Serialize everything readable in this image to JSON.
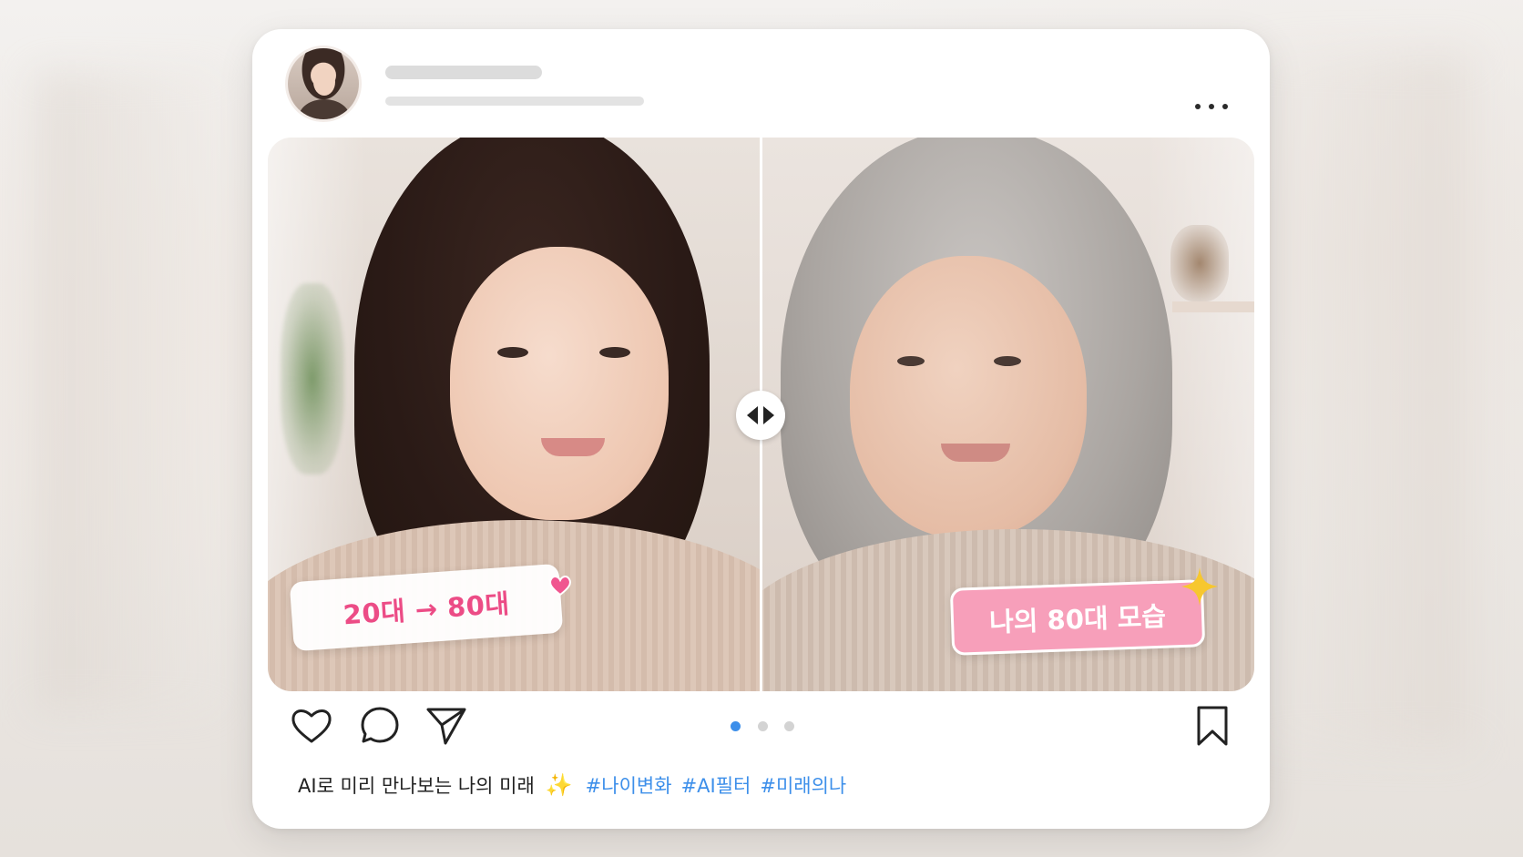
{
  "post": {
    "menu_icon": "more-horizontal-icon",
    "before_label": "20대 → 80대",
    "after_label": "나의 80대 모습",
    "caption_text": "AI로 미리 만나보는 나의 미래",
    "caption_emoji": "✨",
    "hashtags": [
      "#나이변화",
      "#AI필터",
      "#미래의나"
    ],
    "carousel": {
      "total": 3,
      "active": 1
    }
  },
  "actions": {
    "like_icon": "heart-icon",
    "comment_icon": "comment-icon",
    "share_icon": "send-icon",
    "save_icon": "bookmark-icon"
  },
  "colors": {
    "accent": "#3d8fea",
    "label_pink": "#ec4c86",
    "label_pink_bg": "#f79fba",
    "sparkle": "#f3c13a"
  }
}
